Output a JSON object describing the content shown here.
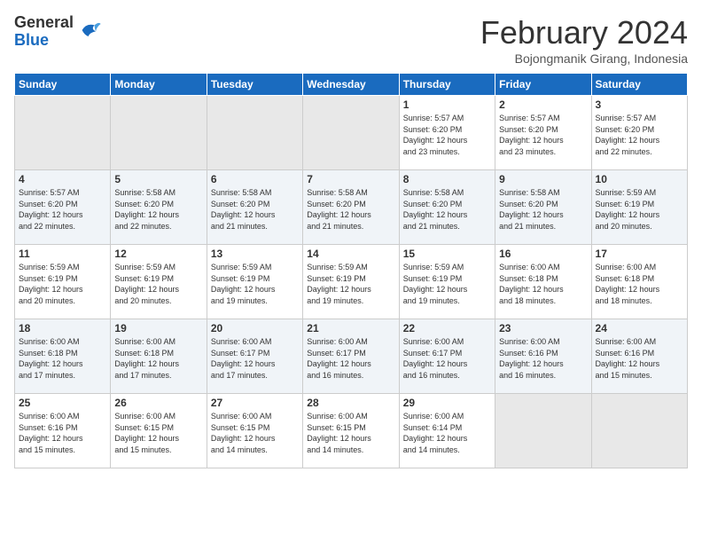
{
  "logo": {
    "general": "General",
    "blue": "Blue"
  },
  "title": "February 2024",
  "subtitle": "Bojongmanik Girang, Indonesia",
  "days_of_week": [
    "Sunday",
    "Monday",
    "Tuesday",
    "Wednesday",
    "Thursday",
    "Friday",
    "Saturday"
  ],
  "weeks": [
    [
      {
        "day": "",
        "content": ""
      },
      {
        "day": "",
        "content": ""
      },
      {
        "day": "",
        "content": ""
      },
      {
        "day": "",
        "content": ""
      },
      {
        "day": "1",
        "content": "Sunrise: 5:57 AM\nSunset: 6:20 PM\nDaylight: 12 hours\nand 23 minutes."
      },
      {
        "day": "2",
        "content": "Sunrise: 5:57 AM\nSunset: 6:20 PM\nDaylight: 12 hours\nand 23 minutes."
      },
      {
        "day": "3",
        "content": "Sunrise: 5:57 AM\nSunset: 6:20 PM\nDaylight: 12 hours\nand 22 minutes."
      }
    ],
    [
      {
        "day": "4",
        "content": "Sunrise: 5:57 AM\nSunset: 6:20 PM\nDaylight: 12 hours\nand 22 minutes."
      },
      {
        "day": "5",
        "content": "Sunrise: 5:58 AM\nSunset: 6:20 PM\nDaylight: 12 hours\nand 22 minutes."
      },
      {
        "day": "6",
        "content": "Sunrise: 5:58 AM\nSunset: 6:20 PM\nDaylight: 12 hours\nand 21 minutes."
      },
      {
        "day": "7",
        "content": "Sunrise: 5:58 AM\nSunset: 6:20 PM\nDaylight: 12 hours\nand 21 minutes."
      },
      {
        "day": "8",
        "content": "Sunrise: 5:58 AM\nSunset: 6:20 PM\nDaylight: 12 hours\nand 21 minutes."
      },
      {
        "day": "9",
        "content": "Sunrise: 5:58 AM\nSunset: 6:20 PM\nDaylight: 12 hours\nand 21 minutes."
      },
      {
        "day": "10",
        "content": "Sunrise: 5:59 AM\nSunset: 6:19 PM\nDaylight: 12 hours\nand 20 minutes."
      }
    ],
    [
      {
        "day": "11",
        "content": "Sunrise: 5:59 AM\nSunset: 6:19 PM\nDaylight: 12 hours\nand 20 minutes."
      },
      {
        "day": "12",
        "content": "Sunrise: 5:59 AM\nSunset: 6:19 PM\nDaylight: 12 hours\nand 20 minutes."
      },
      {
        "day": "13",
        "content": "Sunrise: 5:59 AM\nSunset: 6:19 PM\nDaylight: 12 hours\nand 19 minutes."
      },
      {
        "day": "14",
        "content": "Sunrise: 5:59 AM\nSunset: 6:19 PM\nDaylight: 12 hours\nand 19 minutes."
      },
      {
        "day": "15",
        "content": "Sunrise: 5:59 AM\nSunset: 6:19 PM\nDaylight: 12 hours\nand 19 minutes."
      },
      {
        "day": "16",
        "content": "Sunrise: 6:00 AM\nSunset: 6:18 PM\nDaylight: 12 hours\nand 18 minutes."
      },
      {
        "day": "17",
        "content": "Sunrise: 6:00 AM\nSunset: 6:18 PM\nDaylight: 12 hours\nand 18 minutes."
      }
    ],
    [
      {
        "day": "18",
        "content": "Sunrise: 6:00 AM\nSunset: 6:18 PM\nDaylight: 12 hours\nand 17 minutes."
      },
      {
        "day": "19",
        "content": "Sunrise: 6:00 AM\nSunset: 6:18 PM\nDaylight: 12 hours\nand 17 minutes."
      },
      {
        "day": "20",
        "content": "Sunrise: 6:00 AM\nSunset: 6:17 PM\nDaylight: 12 hours\nand 17 minutes."
      },
      {
        "day": "21",
        "content": "Sunrise: 6:00 AM\nSunset: 6:17 PM\nDaylight: 12 hours\nand 16 minutes."
      },
      {
        "day": "22",
        "content": "Sunrise: 6:00 AM\nSunset: 6:17 PM\nDaylight: 12 hours\nand 16 minutes."
      },
      {
        "day": "23",
        "content": "Sunrise: 6:00 AM\nSunset: 6:16 PM\nDaylight: 12 hours\nand 16 minutes."
      },
      {
        "day": "24",
        "content": "Sunrise: 6:00 AM\nSunset: 6:16 PM\nDaylight: 12 hours\nand 15 minutes."
      }
    ],
    [
      {
        "day": "25",
        "content": "Sunrise: 6:00 AM\nSunset: 6:16 PM\nDaylight: 12 hours\nand 15 minutes."
      },
      {
        "day": "26",
        "content": "Sunrise: 6:00 AM\nSunset: 6:15 PM\nDaylight: 12 hours\nand 15 minutes."
      },
      {
        "day": "27",
        "content": "Sunrise: 6:00 AM\nSunset: 6:15 PM\nDaylight: 12 hours\nand 14 minutes."
      },
      {
        "day": "28",
        "content": "Sunrise: 6:00 AM\nSunset: 6:15 PM\nDaylight: 12 hours\nand 14 minutes."
      },
      {
        "day": "29",
        "content": "Sunrise: 6:00 AM\nSunset: 6:14 PM\nDaylight: 12 hours\nand 14 minutes."
      },
      {
        "day": "",
        "content": ""
      },
      {
        "day": "",
        "content": ""
      }
    ]
  ]
}
